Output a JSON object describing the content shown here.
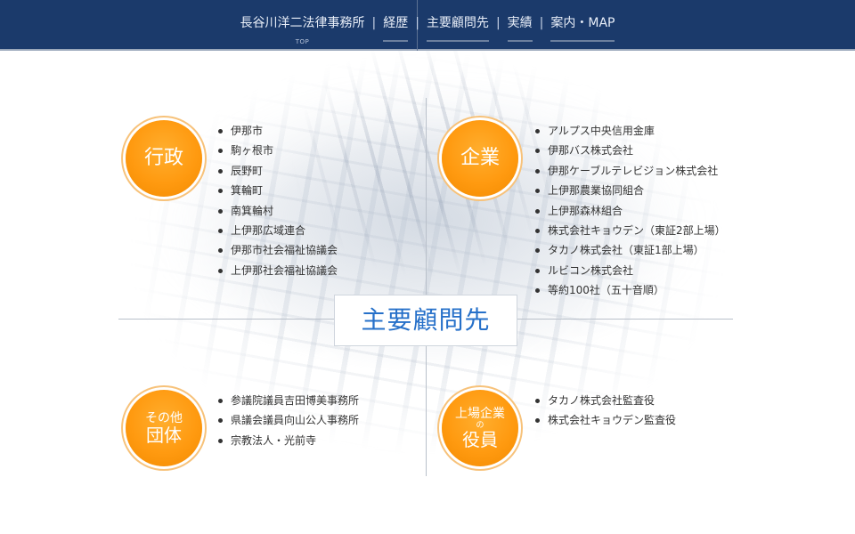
{
  "nav": {
    "items": [
      {
        "label": "長谷川洋二法律事務所",
        "sub": "TOP"
      },
      {
        "label": "経歴"
      },
      {
        "label": "主要顧問先"
      },
      {
        "label": "実績"
      },
      {
        "label": "案内・MAP"
      }
    ],
    "separator": "|"
  },
  "center_title": "主要顧問先",
  "sections": {
    "gyosei": {
      "badge": "行政",
      "items": [
        "伊那市",
        "駒ヶ根市",
        "辰野町",
        "箕輪町",
        "南箕輪村",
        "上伊那広域連合",
        "伊那市社会福祉協議会",
        "上伊那社会福祉協議会"
      ]
    },
    "kigyo": {
      "badge": "企業",
      "items": [
        "アルプス中央信用金庫",
        "伊那バス株式会社",
        "伊那ケーブルテレビジョン株式会社",
        "上伊那農業協同組合",
        "上伊那森林組合",
        "株式会社キョウデン（東証2部上場）",
        "タカノ株式会社（東証1部上場）",
        "ルビコン株式会社",
        "等約100社（五十音順）"
      ]
    },
    "other": {
      "badge_line1": "その他",
      "badge_line2": "団体",
      "items": [
        "参議院議員吉田博美事務所",
        "県議会議員向山公人事務所",
        "宗教法人・光前寺"
      ]
    },
    "yakuin": {
      "badge_line1": "上場企業",
      "badge_line2": "の",
      "badge_line3": "役員",
      "items": [
        "タカノ株式会社監査役",
        "株式会社キョウデン監査役"
      ]
    }
  },
  "colors": {
    "header_bg": "#1b3a6b",
    "accent_orange": "#ff9a10",
    "title_blue": "#2670c9"
  }
}
